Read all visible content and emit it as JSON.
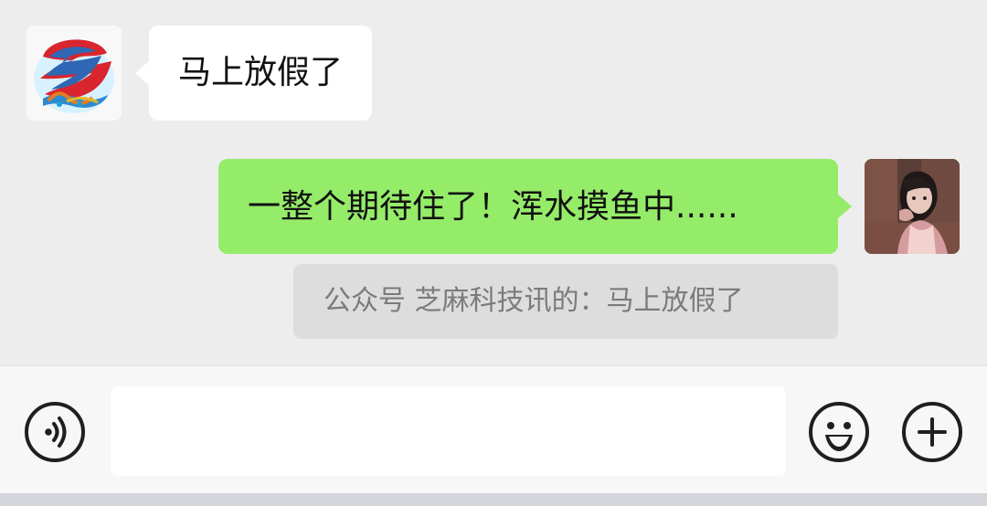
{
  "chat": {
    "messages": [
      {
        "direction": "incoming",
        "text": "马上放假了",
        "avatar": "channel-logo-avatar"
      },
      {
        "direction": "outgoing",
        "text": "一整个期待住了！浑水摸鱼中......",
        "avatar": "user-photo-avatar",
        "quote": "公众号 芝麻科技讯的：马上放假了"
      }
    ]
  },
  "input_bar": {
    "input_value": "",
    "placeholder": "",
    "icons": [
      "voice-icon",
      "emoji-icon",
      "plus-icon"
    ]
  },
  "colors": {
    "background": "#ededed",
    "incoming_bubble": "#ffffff",
    "outgoing_bubble": "#95ec69",
    "quote_box": "#dddddd",
    "quote_text": "#7b7b7b"
  }
}
